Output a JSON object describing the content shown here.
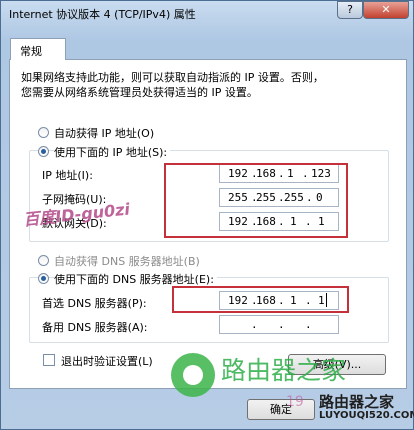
{
  "window": {
    "title": "Internet 协议版本 4 (TCP/IPv4) 属性",
    "help_label": "?",
    "close_label": "✕"
  },
  "tabs": [
    {
      "label": "常规"
    }
  ],
  "description": {
    "line1": "如果网络支持此功能，则可以获取自动指派的 IP 设置。否则，",
    "line2": "您需要从网络系统管理员处获得适当的 IP 设置。"
  },
  "ip_section": {
    "auto_label": "自动获得 IP 地址(O)",
    "manual_label": "使用下面的 IP 地址(S):",
    "selected": "manual",
    "fields": [
      {
        "label": "IP 地址(I):",
        "octets": [
          "192",
          "168",
          "1",
          "123"
        ]
      },
      {
        "label": "子网掩码(U):",
        "octets": [
          "255",
          "255",
          "255",
          "0"
        ]
      },
      {
        "label": "默认网关(D):",
        "octets": [
          "192",
          "168",
          "1",
          "1"
        ]
      }
    ]
  },
  "dns_section": {
    "auto_label": "自动获得 DNS 服务器地址(B)",
    "manual_label": "使用下面的 DNS 服务器地址(E):",
    "selected": "manual",
    "fields": [
      {
        "label": "首选 DNS 服务器(P):",
        "octets": [
          "192",
          "168",
          "1",
          "1"
        ]
      },
      {
        "label": "备用 DNS 服务器(A):",
        "octets": [
          "",
          "",
          "",
          ""
        ]
      }
    ]
  },
  "validate_on_exit": {
    "label": "退出时验证设置(L)",
    "checked": false
  },
  "buttons": {
    "advanced": "高级(V)...",
    "ok": "确定"
  },
  "watermarks": {
    "baidu": "百度ID-gu0zi",
    "logo_cn": "路由器之家",
    "brand": "路由器之家",
    "url": "LUYOUQI520.COM",
    "partial_num": "19"
  },
  "colors": {
    "highlight_box": "#c4313a",
    "logo_green": "#3cb54a"
  }
}
